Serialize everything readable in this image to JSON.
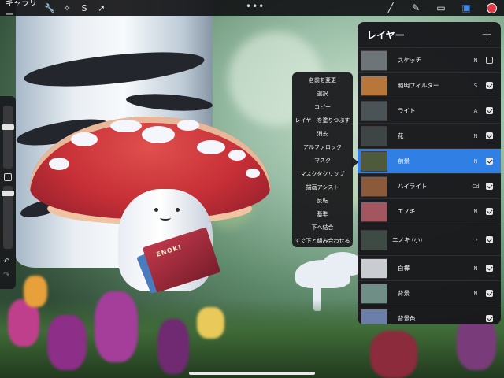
{
  "topbar": {
    "gallery_label": "ギャラリー",
    "left_tools": [
      {
        "icon": "wrench-icon",
        "glyph": "🔧"
      },
      {
        "icon": "magic-wand-icon",
        "glyph": "✧"
      },
      {
        "icon": "selection-icon",
        "glyph": "S"
      },
      {
        "icon": "transform-arrow-icon",
        "glyph": "➚"
      }
    ],
    "more_glyph": "•••",
    "right_tools": [
      {
        "icon": "brush-icon",
        "glyph": "╱"
      },
      {
        "icon": "smudge-icon",
        "glyph": "✎"
      },
      {
        "icon": "eraser-icon",
        "glyph": "▭"
      },
      {
        "icon": "layers-icon",
        "glyph": "▣"
      }
    ],
    "accent_color": "#2f7fe5",
    "current_color": "#e5394a"
  },
  "context_menu": {
    "items": [
      "名前を変更",
      "選択",
      "コピー",
      "レイヤーを塗りつぶす",
      "消去",
      "アルファロック",
      "マスク",
      "マスクをクリップ",
      "描画アシスト",
      "反転",
      "基準",
      "下へ結合",
      "すぐ下と組み合わせる"
    ]
  },
  "layers_panel": {
    "title": "レイヤー",
    "add_glyph": "+",
    "rows": [
      {
        "name": "スケッチ",
        "mode": "N",
        "visible": false,
        "selected": false,
        "thumb": "#6d7578"
      },
      {
        "name": "照明フィルター",
        "mode": "S",
        "visible": true,
        "selected": false,
        "thumb": "#b7773a"
      },
      {
        "name": "ライト",
        "mode": "A",
        "visible": true,
        "selected": false,
        "thumb": "#4a5457"
      },
      {
        "name": "花",
        "mode": "N",
        "visible": true,
        "selected": false,
        "thumb": "#3d4645"
      },
      {
        "name": "前景",
        "mode": "N",
        "visible": true,
        "selected": true,
        "thumb": "#4f5a3c"
      },
      {
        "name": "ハイライト",
        "mode": "Cd",
        "visible": true,
        "selected": false,
        "thumb": "#8a5a3a"
      },
      {
        "name": "エノキ",
        "mode": "N",
        "visible": true,
        "selected": false,
        "thumb": "#a25660"
      },
      {
        "name": "エノキ (小)",
        "mode": "",
        "visible": true,
        "selected": false,
        "thumb": "#3e4a44",
        "group": true
      },
      {
        "name": "白樺",
        "mode": "N",
        "visible": true,
        "selected": false,
        "thumb": "#c9cdd2"
      },
      {
        "name": "背景",
        "mode": "N",
        "visible": true,
        "selected": false,
        "thumb": "#6f8f86"
      },
      {
        "name": "背景色",
        "mode": "",
        "visible": true,
        "selected": false,
        "thumb": "#6b7fa8"
      }
    ]
  },
  "artwork": {
    "book_title": "ENOKI"
  },
  "sidebar": {
    "undo_glyph": "↶",
    "redo_glyph": "↷"
  }
}
